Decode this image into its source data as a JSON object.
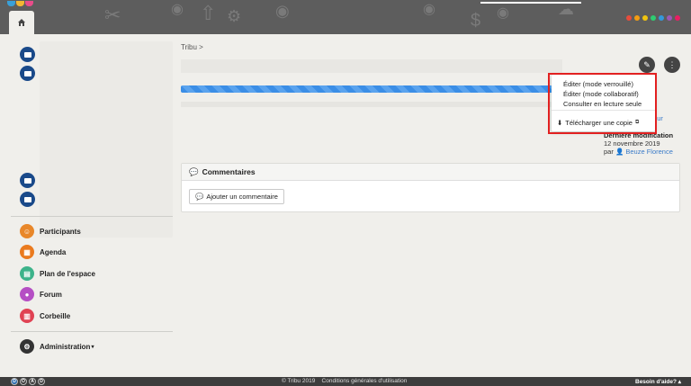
{
  "header": {
    "accent_dots": [
      "#e74c3c",
      "#f39c12",
      "#f1c40f",
      "#2ecc71",
      "#3498db",
      "#9b59b6",
      "#e91e63"
    ]
  },
  "breadcrumb": "Tribu >",
  "progress_fraction": 1.0,
  "document_menu": {
    "items": [
      "Éditer (mode verrouillé)",
      "Éditer (mode collaboratif)",
      "Consulter en lecture seule"
    ],
    "download": "Télécharger une copie"
  },
  "meta": {
    "author_link_fragment": "teur",
    "last_modified_label": "Dernière modification",
    "last_modified_date": "12 novembre 2019",
    "by_label": "par",
    "author_name": "Beuze Florence"
  },
  "comments": {
    "title": "Commentaires",
    "add_label": "Ajouter un commentaire"
  },
  "nav": [
    {
      "label": "Participants",
      "color": "#e8872a"
    },
    {
      "label": "Agenda",
      "color": "#ea7a1e"
    },
    {
      "label": "Plan de l'espace",
      "color": "#3db38a"
    },
    {
      "label": "Forum",
      "color": "#b54fc4"
    },
    {
      "label": "Corbeille",
      "color": "#e04253"
    }
  ],
  "admin": {
    "label": "Administration"
  },
  "footer": {
    "copyright": "© Tribu 2019",
    "terms": "Conditions générales d'utilisation",
    "help": "Besoin d'aide?",
    "badges": [
      "D",
      "O",
      "A",
      "D"
    ]
  }
}
